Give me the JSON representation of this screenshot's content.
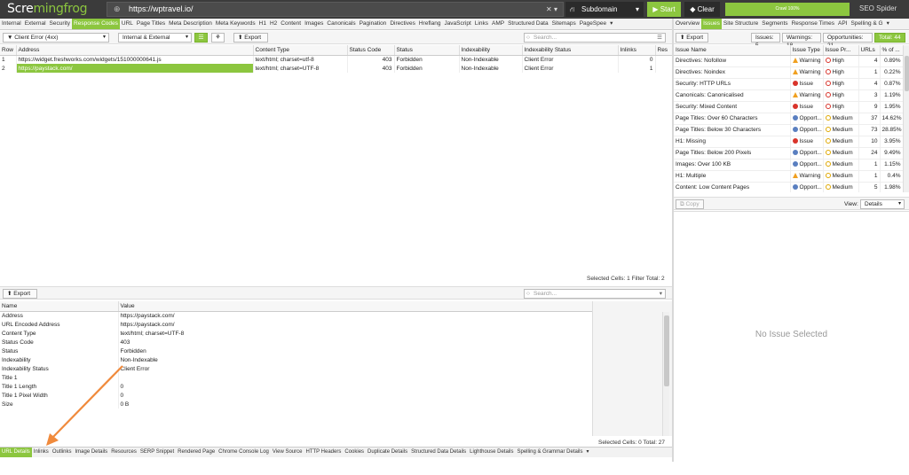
{
  "app": {
    "logo_a": "Scre",
    "logo_b": "mingfrog",
    "url": "https://wptravel.io/",
    "mode": "Subdomain",
    "start": "Start",
    "clear": "Clear",
    "progress_text": "Crawl 100%",
    "progress_fraction": 1.0,
    "brand_label": "SEO Spider",
    "accent": "#8cc63f"
  },
  "top_tabs": [
    "Internal",
    "External",
    "Security",
    "Response Codes",
    "URL",
    "Page Titles",
    "Meta Description",
    "Meta Keywords",
    "H1",
    "H2",
    "Content",
    "Images",
    "Canonicals",
    "Pagination",
    "Directives",
    "Hreflang",
    "JavaScript",
    "Links",
    "AMP",
    "Structured Data",
    "Sitemaps",
    "PageSpee"
  ],
  "top_tabs_active": "Response Codes",
  "right_tabs": [
    "Overview",
    "Issues",
    "Site Structure",
    "Segments",
    "Response Times",
    "API",
    "Spelling & G"
  ],
  "right_tabs_active": "Issues",
  "main_toolbar": {
    "filter": "Client Error (4xx)",
    "scope": "Internal & External",
    "export": "Export",
    "search_placeholder": "Search..."
  },
  "main_table": {
    "headers": [
      "Row",
      "Address",
      "Content Type",
      "Status Code",
      "Status",
      "Indexability",
      "Indexability Status",
      "Inlinks",
      "Res"
    ],
    "rows": [
      {
        "row": "1",
        "address": "https://widget.freshworks.com/widgets/151000000641.js",
        "content_type": "text/html; charset=utf-8",
        "status_code": "403",
        "status": "Forbidden",
        "indexability": "Non-Indexable",
        "indexability_status": "Client Error",
        "inlinks": "0"
      },
      {
        "row": "2",
        "address": "https://paystack.com/",
        "content_type": "text/html; charset=UTF-8",
        "status_code": "403",
        "status": "Forbidden",
        "indexability": "Non-Indexable",
        "indexability_status": "Client Error",
        "inlinks": "1"
      }
    ],
    "status": "Selected Cells:  1  Filter Total:  2"
  },
  "lower_toolbar": {
    "export": "Export",
    "search_placeholder": "Search..."
  },
  "detail_table": {
    "headers": [
      "Name",
      "Value"
    ],
    "rows": [
      {
        "name": "Address",
        "value": "https://paystack.com/"
      },
      {
        "name": "URL Encoded Address",
        "value": "https://paystack.com/"
      },
      {
        "name": "Content Type",
        "value": "text/html; charset=UTF-8"
      },
      {
        "name": "Status Code",
        "value": "403"
      },
      {
        "name": "Status",
        "value": "Forbidden"
      },
      {
        "name": "Indexability",
        "value": "Non-Indexable"
      },
      {
        "name": "Indexability Status",
        "value": "Client Error"
      },
      {
        "name": "Title 1",
        "value": ""
      },
      {
        "name": "Title 1 Length",
        "value": "0"
      },
      {
        "name": "Title 1 Pixel Width",
        "value": "0"
      },
      {
        "name": "Size",
        "value": "0 B"
      }
    ],
    "status": "Selected Cells:  0  Total:  27"
  },
  "bottom_tabs": [
    "URL Details",
    "Inlinks",
    "Outlinks",
    "Image Details",
    "Resources",
    "SERP Snippet",
    "Rendered Page",
    "Chrome Console Log",
    "View Source",
    "HTTP Headers",
    "Cookies",
    "Duplicate Details",
    "Structured Data Details",
    "Lighthouse Details",
    "Spelling & Grammar Details"
  ],
  "bottom_tabs_active": "URL Details",
  "issues_toolbar": {
    "export": "Export",
    "issues": "Issues: 5",
    "warnings": "Warnings: 18",
    "opportunities": "Opportunities: 21",
    "total": "Total: 44"
  },
  "issues_table": {
    "headers": [
      "Issue Name",
      "Issue Type",
      "Issue Pr...",
      "URLs",
      "% of ..."
    ],
    "rows": [
      {
        "name": "Directives: Nofollow",
        "type": "Warning",
        "type_kind": "warning",
        "priority": "High",
        "priority_kind": "high",
        "urls": "4",
        "pct": "0.89%"
      },
      {
        "name": "Directives: Noindex",
        "type": "Warning",
        "type_kind": "warning",
        "priority": "High",
        "priority_kind": "high",
        "urls": "1",
        "pct": "0.22%"
      },
      {
        "name": "Security: HTTP URLs",
        "type": "Issue",
        "type_kind": "issue",
        "priority": "High",
        "priority_kind": "high",
        "urls": "4",
        "pct": "0.87%"
      },
      {
        "name": "Canonicals: Canonicalised",
        "type": "Warning",
        "type_kind": "warning",
        "priority": "High",
        "priority_kind": "high",
        "urls": "3",
        "pct": "1.19%"
      },
      {
        "name": "Security: Mixed Content",
        "type": "Issue",
        "type_kind": "issue",
        "priority": "High",
        "priority_kind": "high",
        "urls": "9",
        "pct": "1.95%"
      },
      {
        "name": "Page Titles: Over 60 Characters",
        "type": "Opport...",
        "type_kind": "opportunity",
        "priority": "Medium",
        "priority_kind": "medium",
        "urls": "37",
        "pct": "14.62%"
      },
      {
        "name": "Page Titles: Below 30 Characters",
        "type": "Opport...",
        "type_kind": "opportunity",
        "priority": "Medium",
        "priority_kind": "medium",
        "urls": "73",
        "pct": "28.85%"
      },
      {
        "name": "H1: Missing",
        "type": "Issue",
        "type_kind": "issue",
        "priority": "Medium",
        "priority_kind": "medium",
        "urls": "10",
        "pct": "3.95%"
      },
      {
        "name": "Page Titles: Below 200 Pixels",
        "type": "Opport...",
        "type_kind": "opportunity",
        "priority": "Medium",
        "priority_kind": "medium",
        "urls": "24",
        "pct": "9.49%"
      },
      {
        "name": "Images: Over 100 KB",
        "type": "Opport...",
        "type_kind": "opportunity",
        "priority": "Medium",
        "priority_kind": "medium",
        "urls": "1",
        "pct": "1.15%"
      },
      {
        "name": "H1: Multiple",
        "type": "Warning",
        "type_kind": "warning",
        "priority": "Medium",
        "priority_kind": "medium",
        "urls": "1",
        "pct": "0.4%"
      },
      {
        "name": "Content: Low Content Pages",
        "type": "Opport...",
        "type_kind": "opportunity",
        "priority": "Medium",
        "priority_kind": "medium",
        "urls": "5",
        "pct": "1.98%"
      }
    ]
  },
  "issue_detail": {
    "copy": "Copy",
    "view_label": "View:",
    "view_value": "Details",
    "empty_text": "No Issue Selected"
  },
  "colors": {
    "issue": "#d9342b",
    "warning": "#f0a020",
    "opportunity": "#5a7fc0",
    "high": "#d9342b",
    "medium": "#e0a800",
    "arrow": "#f08a3c"
  }
}
